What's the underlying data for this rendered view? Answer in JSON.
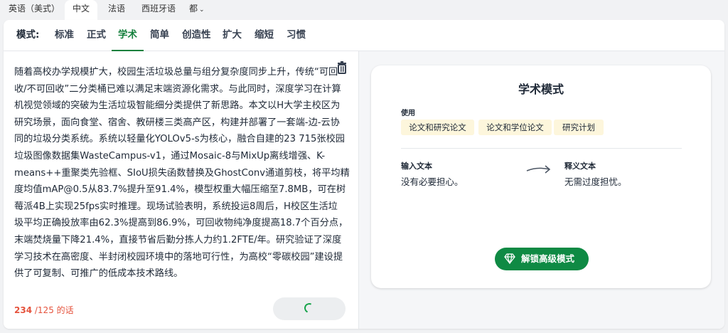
{
  "languages": [
    {
      "label": "英语（美式）"
    },
    {
      "label": "中文",
      "active": true
    },
    {
      "label": "法语"
    },
    {
      "label": "西班牙语"
    },
    {
      "label": "都"
    }
  ],
  "modes": {
    "label": "模式:",
    "items": [
      "标准",
      "正式",
      "学术",
      "简单",
      "创造性",
      "扩大",
      "缩短",
      "习惯"
    ],
    "active": "学术"
  },
  "input": {
    "lines": [
      "随着高校办学规模扩大，校园生活垃圾总量与组分复杂度同步上升，传统“可回",
      "收/不可回收”二分类桶已难以满足末端资源化需求。与此同时，深度学习在计算",
      "机视觉领域的突破为生活垃圾智能细分类提供了新思路。本文以H大学主校区为",
      "研究场景，面向食堂、宿舍、教研楼三类高产区，构建并部署了一套端-边-云协",
      "同的垃圾分类系统。系统以轻量化YOLOv5-s为核心，融合自建的23 715张校园",
      "垃圾图像数据集WasteCampus-v1，通过Mosaic-8与MixUp离线增强、K-",
      "means++重聚类先验框、SIoU损失函数替换及GhostConv通道剪枝，将平均精",
      "度均值mAP@0.5从83.7%提升至91.4%，模型权重大幅压缩至7.8MB，可在树",
      "莓派4B上实现25fps实时推理。现场试验表明，系统投运8周后，H校区生活垃",
      "圾平均正确投放率由62.3%提高到86.9%，可回收物纯净度提高18.7个百分点，",
      "末端焚烧量下降21.4%，直接节省后勤分拣人力约1.2FTE/年。研究验证了深度",
      "学习技术在高密度、半封闭校园环境中的落地可行性，为高校“零碳校园”建设提",
      "供了可复制、可推广的低成本技术路线。"
    ],
    "word_count": "234",
    "word_limit": " /125 的话"
  },
  "info": {
    "title": "学术模式",
    "use_label": "使用",
    "chips": [
      "论文和研究论文",
      "论文和学位论文",
      "研究计划"
    ],
    "input_label": "输入文本",
    "input_example": "没有必要担心。",
    "output_label": "释义文本",
    "output_example": "无需过度担忧。",
    "unlock_label": "解锁高级模式"
  },
  "colors": {
    "accent": "#15803d",
    "button": "#0f8a44",
    "chip": "#fdf6dc",
    "count": "#e5533d"
  }
}
